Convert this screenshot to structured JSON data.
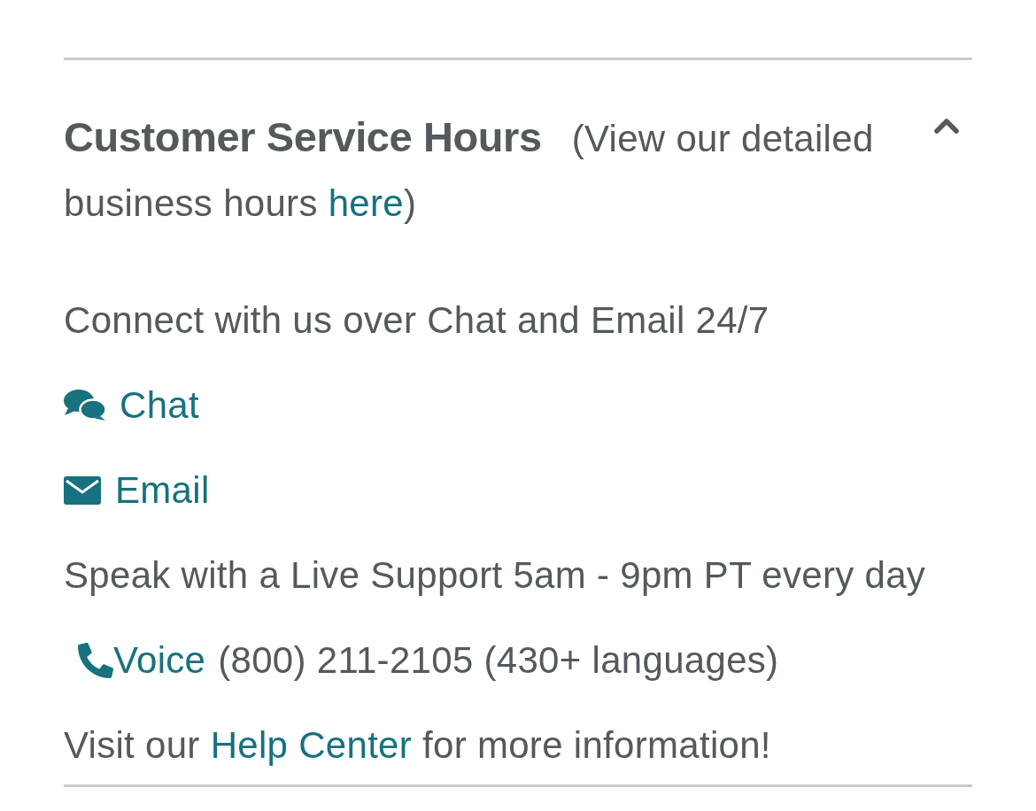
{
  "section": {
    "title": "Customer Service Hours",
    "expanded": true,
    "note": {
      "before": "(View our detailed business hours ",
      "link": "here",
      "after": ")"
    }
  },
  "content": [
    {
      "kind": "text",
      "text": "Connect with us over Chat and Email 24/7"
    },
    {
      "kind": "chat",
      "label": "Chat"
    },
    {
      "kind": "email",
      "label": "Email"
    },
    {
      "kind": "text",
      "text": "Speak with a Live Support 5am - 9pm PT every day"
    },
    {
      "kind": "phone",
      "label": "Voice",
      "detail": "(800) 211-2105 (430+ languages)"
    },
    {
      "kind": "help",
      "before": "Visit our ",
      "link": "Help Center",
      "after": " for more information!"
    }
  ]
}
